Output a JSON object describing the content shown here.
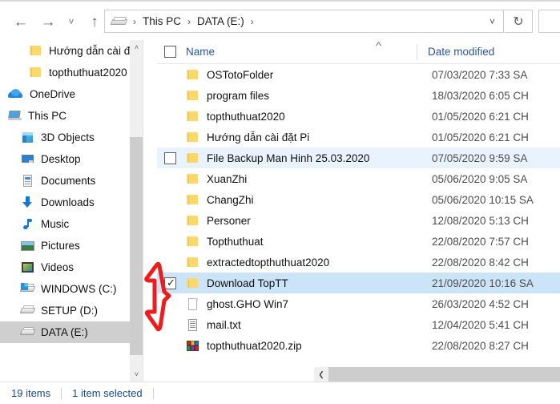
{
  "window": {
    "title": "DATA (E:)"
  },
  "nav": {
    "back_icon": "arrow-left-icon",
    "forward_icon": "arrow-right-icon",
    "recent_icon": "chevron-down-icon",
    "up_icon": "arrow-up-icon",
    "refresh_icon": "refresh-icon",
    "address_dropdown_icon": "chevron-down-icon",
    "breadcrumb": [
      {
        "label": "This PC",
        "icon": "drive-icon"
      },
      {
        "label": "DATA (E:)",
        "icon": ""
      }
    ],
    "breadcrumb_separator": "›"
  },
  "sidebar": {
    "items": [
      {
        "label": "Hướng dẫn cài đ",
        "icon": "folder-icon",
        "indent": 1,
        "selected": false
      },
      {
        "label": "topthuthuat2020",
        "icon": "folder-icon",
        "indent": 1,
        "selected": false
      },
      {
        "label": "OneDrive",
        "icon": "onedrive-cloud-icon",
        "indent": 0,
        "selected": false
      },
      {
        "label": "This PC",
        "icon": "this-pc-icon",
        "indent": 0,
        "selected": false
      },
      {
        "label": "3D Objects",
        "icon": "3d-objects-icon",
        "indent": 2,
        "selected": false
      },
      {
        "label": "Desktop",
        "icon": "desktop-icon",
        "indent": 2,
        "selected": false
      },
      {
        "label": "Documents",
        "icon": "documents-icon",
        "indent": 2,
        "selected": false
      },
      {
        "label": "Downloads",
        "icon": "downloads-icon",
        "indent": 2,
        "selected": false
      },
      {
        "label": "Music",
        "icon": "music-icon",
        "indent": 2,
        "selected": false
      },
      {
        "label": "Pictures",
        "icon": "pictures-icon",
        "indent": 2,
        "selected": false
      },
      {
        "label": "Videos",
        "icon": "videos-icon",
        "indent": 2,
        "selected": false
      },
      {
        "label": "WINDOWS (C:)",
        "icon": "windows-drive-icon",
        "indent": 2,
        "selected": false
      },
      {
        "label": "SETUP (D:)",
        "icon": "drive-icon",
        "indent": 2,
        "selected": false
      },
      {
        "label": "DATA (E:)",
        "icon": "drive-icon",
        "indent": 2,
        "selected": true
      }
    ],
    "scroll_up_icon": "chevron-up-icon",
    "scroll_down_icon": "chevron-down-icon"
  },
  "filelist": {
    "columns": {
      "select_all_checkbox": "unchecked",
      "name": "Name",
      "date_modified": "Date modified",
      "sort_indicator": "ascending"
    },
    "rows": [
      {
        "name": "OSTotoFolder",
        "date": "07/03/2020 7:33 SA",
        "icon": "folder-icon",
        "state": "normal",
        "checkbox": "none"
      },
      {
        "name": "program files",
        "date": "18/03/2020 6:05 CH",
        "icon": "folder-icon",
        "state": "normal",
        "checkbox": "none"
      },
      {
        "name": "topthuthuat2020",
        "date": "01/05/2020 6:21 CH",
        "icon": "folder-icon",
        "state": "normal",
        "checkbox": "none"
      },
      {
        "name": "Hướng dẫn cài đặt Pi",
        "date": "01/05/2020 6:21 CH",
        "icon": "folder-icon",
        "state": "normal",
        "checkbox": "none"
      },
      {
        "name": "File Backup Man Hinh 25.03.2020",
        "date": "07/05/2020 9:59 SA",
        "icon": "folder-icon",
        "state": "hover",
        "checkbox": "unchecked"
      },
      {
        "name": "XuanZhi",
        "date": "05/06/2020 9:05 SA",
        "icon": "folder-icon",
        "state": "normal",
        "checkbox": "none"
      },
      {
        "name": "ChangZhi",
        "date": "05/06/2020 10:15 SA",
        "icon": "folder-icon",
        "state": "normal",
        "checkbox": "none"
      },
      {
        "name": "Personer",
        "date": "12/08/2020 5:13 CH",
        "icon": "folder-icon",
        "state": "normal",
        "checkbox": "none"
      },
      {
        "name": "Topthuthuat",
        "date": "22/08/2020 7:57 CH",
        "icon": "folder-icon",
        "state": "normal",
        "checkbox": "none"
      },
      {
        "name": "extractedtopthuthuat2020",
        "date": "22/08/2020 8:42 CH",
        "icon": "folder-icon",
        "state": "normal",
        "checkbox": "none"
      },
      {
        "name": "Download TopTT",
        "date": "21/09/2020 10:16 SA",
        "icon": "folder-icon",
        "state": "selected",
        "checkbox": "checked"
      },
      {
        "name": "ghost.GHO Win7",
        "date": "26/03/2020 4:52 CH",
        "icon": "file-icon",
        "state": "normal",
        "checkbox": "none"
      },
      {
        "name": "mail.txt",
        "date": "12/04/2020 5:41 CH",
        "icon": "text-file-icon",
        "state": "normal",
        "checkbox": "none"
      },
      {
        "name": "topthuthuat2020.zip",
        "date": "22/08/2020 8:27 CH",
        "icon": "archive-icon",
        "state": "normal",
        "checkbox": "none"
      }
    ],
    "checkmark_glyph": "✓",
    "hscroll_left_icon": "chevron-left-icon"
  },
  "status": {
    "item_count": "19 items",
    "selection": "1 item selected"
  },
  "annotation": {
    "type": "red-arrow",
    "color": "#ee1c1c",
    "points_at": "row-checkbox"
  },
  "colors": {
    "accent_header": "#2b5797",
    "row_selected": "#cbe4f7",
    "row_hover": "#e9f3fd",
    "sidebar_selected": "#cfcfcf",
    "status_text": "#1b4a87",
    "annotation_red": "#ee1c1c"
  }
}
